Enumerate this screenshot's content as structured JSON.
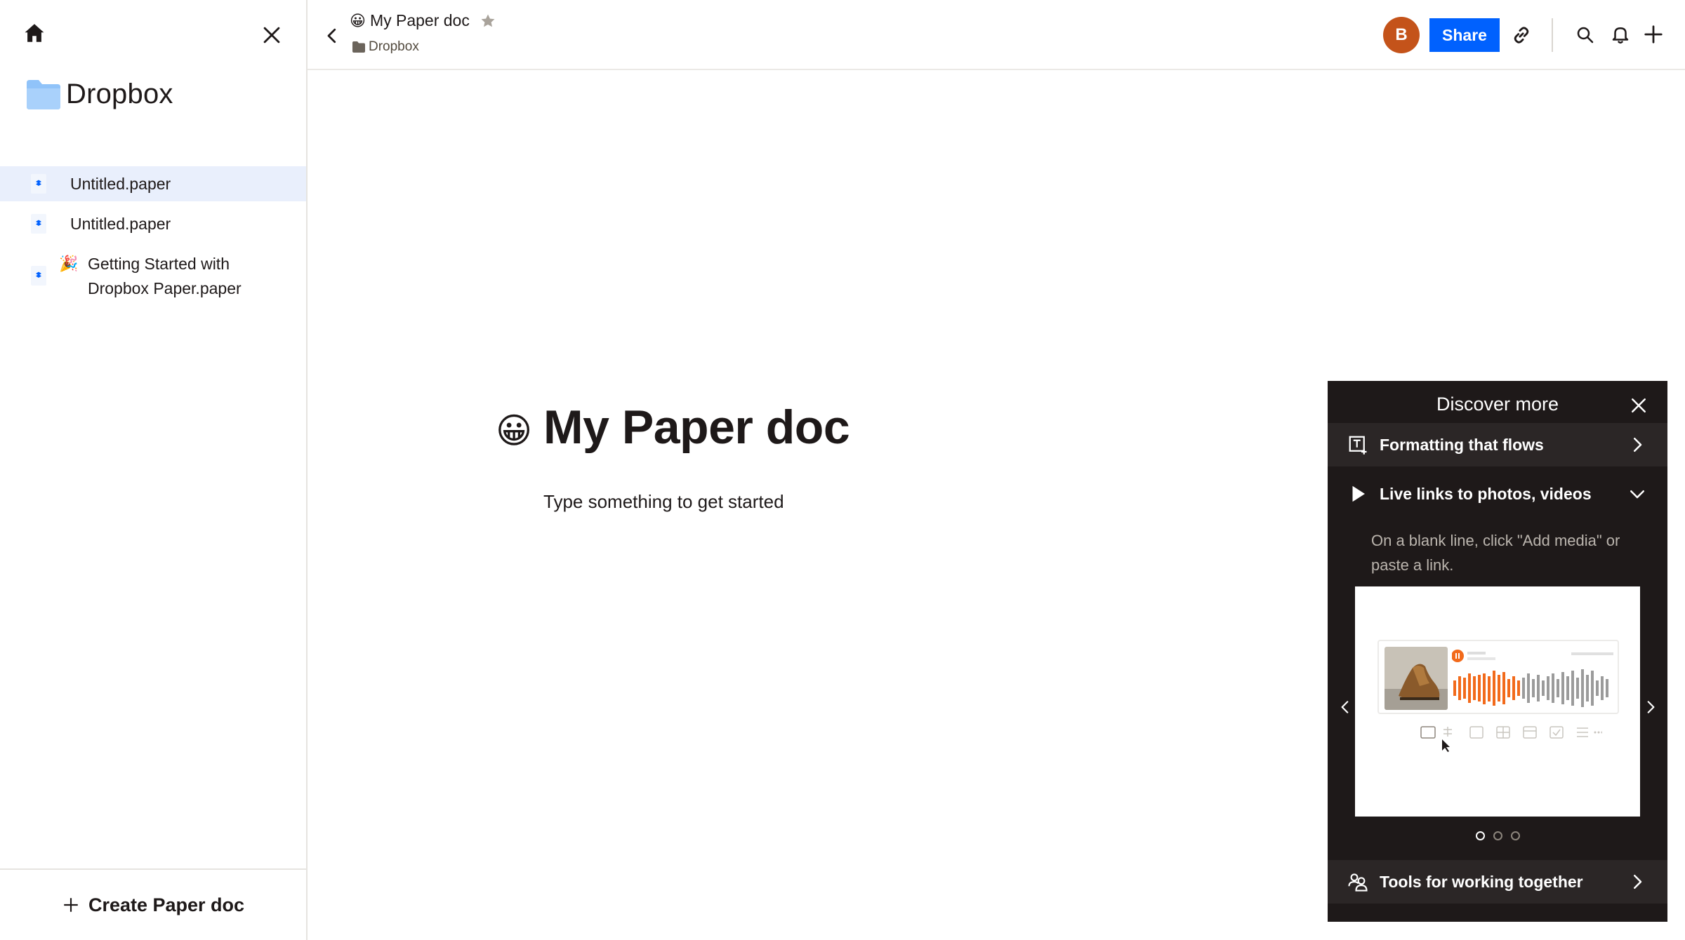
{
  "sidebar": {
    "brand": "Dropbox",
    "files": [
      {
        "label": "Untitled.paper",
        "active": true
      },
      {
        "label": "Untitled.paper",
        "active": false
      },
      {
        "label": "Getting Started with Dropbox Paper.paper",
        "emoji": "🎉",
        "active": false
      }
    ],
    "create_label": "Create Paper doc"
  },
  "topbar": {
    "title_emoji": "😀",
    "title": "My Paper doc",
    "breadcrumb": "Dropbox",
    "avatar_initial": "B",
    "share_label": "Share"
  },
  "document": {
    "emoji": "😀",
    "heading": "My Paper doc",
    "placeholder": "Type something to get started"
  },
  "discover_panel": {
    "title": "Discover more",
    "items": [
      {
        "label": "Formatting that flows",
        "icon": "text-format-icon",
        "expanded": false
      },
      {
        "label": "Live links to photos, videos",
        "icon": "play-icon",
        "expanded": true
      },
      {
        "label": "Tools for working together",
        "icon": "people-icon",
        "expanded": false
      }
    ],
    "expanded_description": "On a blank line, click \"Add media\" or paste a link.",
    "carousel_pages": 3,
    "carousel_active": 1
  },
  "colors": {
    "accent": "#0061fe",
    "avatar": "#c4531a",
    "panel_bg": "#1e1919",
    "active_item_bg": "#e9effc",
    "folder": "#90c3f9"
  }
}
